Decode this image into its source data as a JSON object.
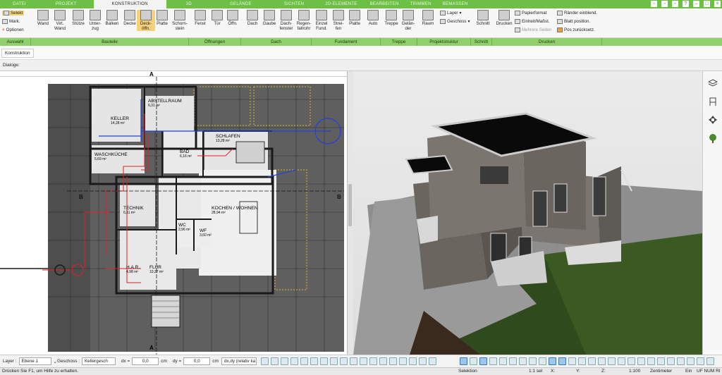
{
  "tabs": [
    "DATEI",
    "PROJEKT",
    "KONSTRUKTION",
    "3D",
    "GELÄNDE",
    "SICHTEN",
    "2D-ELEMENTE",
    "BEARBEITEN",
    "TRIMMEN",
    "BEMASSEN"
  ],
  "ribbon": {
    "auswahl": {
      "selekt": "Selekt",
      "mark": "Mark.",
      "optionen": "Optionen"
    },
    "bauteile": [
      "Wand",
      "Virt. Wand",
      "Stütze",
      "Unter-zug",
      "Balken",
      "Decke",
      "Deck-öffn.",
      "Platte",
      "Schorn-stein"
    ],
    "oeffnungen": [
      "Fenst",
      "Tür",
      "Öffn."
    ],
    "dach": [
      "Dach",
      "Gaube",
      "Dach-fenster",
      "Regen-fallrohr"
    ],
    "fundament": [
      "Einzel Fund.",
      "Strei-fen",
      "Platte"
    ],
    "auto": "Auto",
    "treppe": [
      "Treppe",
      "Gelän-der"
    ],
    "raum": "Raum",
    "layer": "Layer",
    "geschoss": "Geschoss",
    "schnitt": "Schnitt",
    "drucken": "Drucken",
    "druck_opts": [
      "Papierformat",
      "Einheit/Maßst.",
      "Mehrere Seiten"
    ],
    "druck_opts2": [
      "Ränder einblend.",
      "Blatt position.",
      "Pos zurücksetz."
    ]
  },
  "groups": [
    "Auswahl",
    "Bauteile",
    "Öffnungen",
    "Dach",
    "Fundament",
    "Treppe",
    "Projektstruktur",
    "Schnitt",
    "Drucken"
  ],
  "bar2": {
    "chip": "Konstruktion"
  },
  "bar3": {
    "label": "Dialoge:"
  },
  "plan": {
    "rooms": [
      {
        "name": "KELLER",
        "area": "14,28 m²"
      },
      {
        "name": "ABSTELLRAUM",
        "area": "6,31 m²"
      },
      {
        "name": "WASCHKÜCHE",
        "area": "5,69 m²"
      },
      {
        "name": "SCHLAFEN",
        "area": "13,28 m²"
      },
      {
        "name": "BAD",
        "area": "6,16 m²"
      },
      {
        "name": "KOCHEN / WOHNEN",
        "area": "28,94 m²"
      },
      {
        "name": "TECHNIK",
        "area": "6,11 m²"
      },
      {
        "name": "WC",
        "area": "2,96 m²"
      },
      {
        "name": "WF",
        "area": "3,60 m²"
      },
      {
        "name": "H.A.R.",
        "area": "4,98 m²"
      },
      {
        "name": "FLUR",
        "area": "10,27 m²"
      }
    ],
    "section_a": "A",
    "section_b": "B"
  },
  "bottombar": {
    "layer_label": "Layer :",
    "layer_value": "Ebene 1",
    "geschoss_label": "Geschoss :",
    "geschoss_value": "Kellergesch",
    "dx_label": "dx =",
    "dx_value": "0,0",
    "dx_unit": "cm",
    "dy_label": "dy =",
    "dy_value": "0,0",
    "dy_unit": "cm",
    "mode": "dx,dy (relativ ka"
  },
  "status": {
    "hint": "Drücken Sie F1, um Hilfe zu erhalten.",
    "mode": "Selektion",
    "sel": "1:1 sel",
    "x": "X:",
    "y": "Y:",
    "z": "Z:",
    "scale": "1:100",
    "unit": "Zentimeter",
    "ein": "Ein",
    "flags": "UF NUM RI"
  },
  "colors": {
    "green": "#6dbf45",
    "green_light": "#8fd06c",
    "highlight": "#f5d27a"
  }
}
